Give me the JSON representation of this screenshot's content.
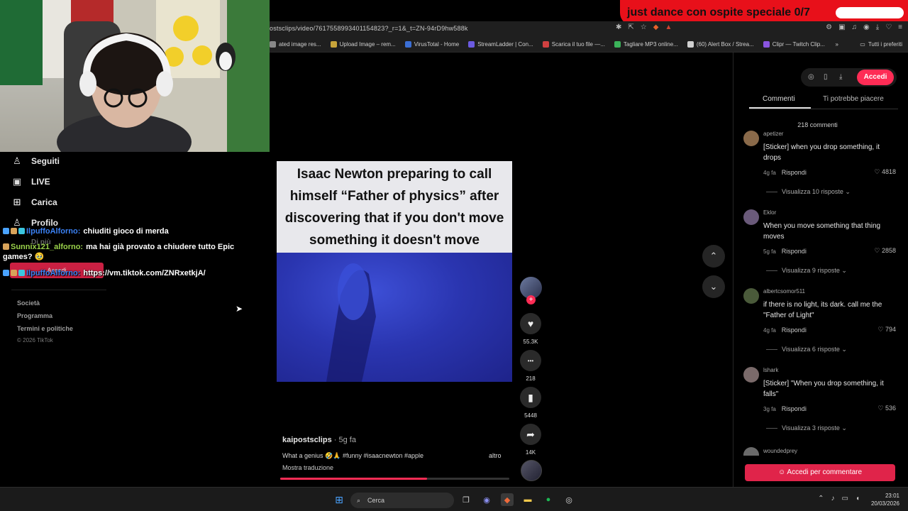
{
  "overlay": {
    "title": "just dance con ospite speciale 0/7"
  },
  "browser": {
    "url": "ostsclips/video/7617558993401154823?_r=1&_t=ZN-94rD9hw588k",
    "bookmarks": [
      {
        "label": "ated image res...",
        "color": "#888888"
      },
      {
        "label": "Upload Image – rem...",
        "color": "#c7a43a"
      },
      {
        "label": "VirusTotal - Home",
        "color": "#3b6fd6"
      },
      {
        "label": "StreamLadder | Con...",
        "color": "#6b5ae0"
      },
      {
        "label": "Scarica il tuo file —...",
        "color": "#d04040"
      },
      {
        "label": "Tagliare MP3 online...",
        "color": "#3bb35a"
      },
      {
        "label": "(60) Alert Box / Strea...",
        "color": "#d0d0d0"
      },
      {
        "label": "Clipr — Twitch Clip...",
        "color": "#8a55e0"
      }
    ],
    "bookmarks_more": "»",
    "all_bookmarks": "Tutti i preferiti"
  },
  "left_nav": {
    "items": [
      {
        "label": "Seguiti",
        "icon": "people-icon",
        "glyph": "♙"
      },
      {
        "label": "LIVE",
        "icon": "live-icon",
        "glyph": "▣"
      },
      {
        "label": "Carica",
        "icon": "upload-icon",
        "glyph": "⊞"
      },
      {
        "label": "Profilo",
        "icon": "profile-icon",
        "glyph": "♙"
      }
    ],
    "hidden_item": "Di più",
    "login_label": "Accedi",
    "footer": [
      "Società",
      "Programma",
      "Termini e politiche",
      "© 2026 TikTok"
    ]
  },
  "chat": [
    {
      "user": "IlpuffoAlforno:",
      "user_color": "#3b82f6",
      "message": "chiuditi gioco di merda"
    },
    {
      "user": "Sunnix121_alforno:",
      "user_color": "#9ad24a",
      "message": "ma hai già provato a chiudere tutto Epic games? 🥹"
    },
    {
      "user": "IlpuffoAlforno:",
      "user_color": "#3b82f6",
      "message": "https://vm.tiktok.com/ZNRxetkjA/"
    }
  ],
  "video": {
    "caption": "Isaac Newton preparing to call himself “Father of physics” after discovering that if you don't move something it doesn't move",
    "author": "kaipostsclips",
    "posted": "· 5g fa",
    "description": "What a genius 🤣🙏 #funny #isaacnewton #apple",
    "more": "altro",
    "translate": "Mostra traduzione",
    "progress": 0.64
  },
  "actions": [
    {
      "icon": "heart-icon",
      "glyph": "♥",
      "count": "55.3K"
    },
    {
      "icon": "comment-icon",
      "glyph": "•••",
      "count": "218"
    },
    {
      "icon": "bookmark-icon",
      "glyph": "▮",
      "count": "5448"
    },
    {
      "icon": "share-icon",
      "glyph": "➦",
      "count": "14K"
    }
  ],
  "right_panel": {
    "login": "Accedi",
    "tabs": [
      "Commenti",
      "Ti potrebbe piacere"
    ],
    "comment_count": "218 commenti",
    "comments": [
      {
        "user": "apetizer",
        "text": "[Sticker] when you drop something, it drops",
        "time": "4g fa",
        "reply": "Rispondi",
        "likes": "4818",
        "replies": "Visualizza 10 risposte",
        "avatar": "#8a6a4a"
      },
      {
        "user": "Eklor",
        "text": "When you move something that thing moves",
        "time": "5g fa",
        "reply": "Rispondi",
        "likes": "2858",
        "replies": "Visualizza 9 risposte",
        "avatar": "#6a5a7a"
      },
      {
        "user": "albertcsomor511",
        "text": "if there is no light, its dark. call me the \"Father of Light\"",
        "time": "4g fa",
        "reply": "Rispondi",
        "likes": "794",
        "replies": "Visualizza 6 risposte",
        "avatar": "#4a5a3a"
      },
      {
        "user": "lshark",
        "text": "[Sticker] \"When you drop something, it falls\"",
        "time": "3g fa",
        "reply": "Rispondi",
        "likes": "536",
        "replies": "Visualizza 3 risposte",
        "avatar": "#7a6a6a"
      }
    ],
    "next_user": "woundedprey",
    "comment_login": "Accedi per commentare"
  },
  "taskbar": {
    "search": "Cerca",
    "time": "23:01",
    "date": "20/03/2026"
  }
}
